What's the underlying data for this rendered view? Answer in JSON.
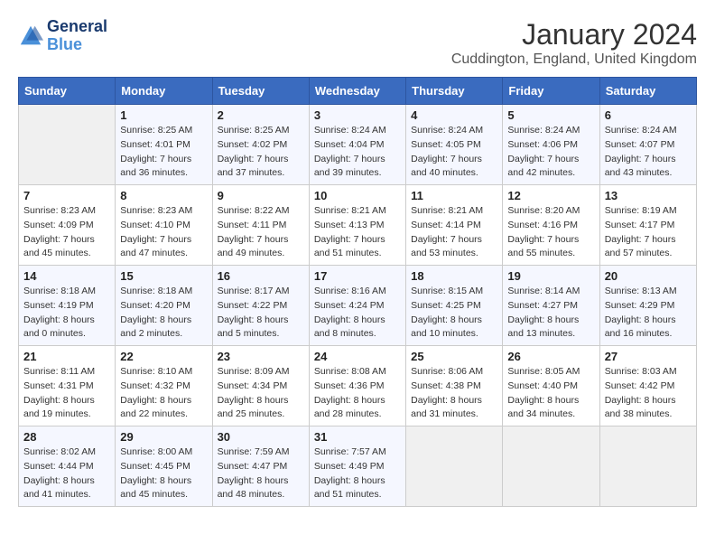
{
  "header": {
    "logo_line1": "General",
    "logo_line2": "Blue",
    "month": "January 2024",
    "location": "Cuddington, England, United Kingdom"
  },
  "days_of_week": [
    "Sunday",
    "Monday",
    "Tuesday",
    "Wednesday",
    "Thursday",
    "Friday",
    "Saturday"
  ],
  "weeks": [
    [
      {
        "num": "",
        "empty": true
      },
      {
        "num": "1",
        "sunrise": "8:25 AM",
        "sunset": "4:01 PM",
        "daylight": "7 hours and 36 minutes."
      },
      {
        "num": "2",
        "sunrise": "8:25 AM",
        "sunset": "4:02 PM",
        "daylight": "7 hours and 37 minutes."
      },
      {
        "num": "3",
        "sunrise": "8:24 AM",
        "sunset": "4:04 PM",
        "daylight": "7 hours and 39 minutes."
      },
      {
        "num": "4",
        "sunrise": "8:24 AM",
        "sunset": "4:05 PM",
        "daylight": "7 hours and 40 minutes."
      },
      {
        "num": "5",
        "sunrise": "8:24 AM",
        "sunset": "4:06 PM",
        "daylight": "7 hours and 42 minutes."
      },
      {
        "num": "6",
        "sunrise": "8:24 AM",
        "sunset": "4:07 PM",
        "daylight": "7 hours and 43 minutes."
      }
    ],
    [
      {
        "num": "7",
        "sunrise": "8:23 AM",
        "sunset": "4:09 PM",
        "daylight": "7 hours and 45 minutes."
      },
      {
        "num": "8",
        "sunrise": "8:23 AM",
        "sunset": "4:10 PM",
        "daylight": "7 hours and 47 minutes."
      },
      {
        "num": "9",
        "sunrise": "8:22 AM",
        "sunset": "4:11 PM",
        "daylight": "7 hours and 49 minutes."
      },
      {
        "num": "10",
        "sunrise": "8:21 AM",
        "sunset": "4:13 PM",
        "daylight": "7 hours and 51 minutes."
      },
      {
        "num": "11",
        "sunrise": "8:21 AM",
        "sunset": "4:14 PM",
        "daylight": "7 hours and 53 minutes."
      },
      {
        "num": "12",
        "sunrise": "8:20 AM",
        "sunset": "4:16 PM",
        "daylight": "7 hours and 55 minutes."
      },
      {
        "num": "13",
        "sunrise": "8:19 AM",
        "sunset": "4:17 PM",
        "daylight": "7 hours and 57 minutes."
      }
    ],
    [
      {
        "num": "14",
        "sunrise": "8:18 AM",
        "sunset": "4:19 PM",
        "daylight": "8 hours and 0 minutes."
      },
      {
        "num": "15",
        "sunrise": "8:18 AM",
        "sunset": "4:20 PM",
        "daylight": "8 hours and 2 minutes."
      },
      {
        "num": "16",
        "sunrise": "8:17 AM",
        "sunset": "4:22 PM",
        "daylight": "8 hours and 5 minutes."
      },
      {
        "num": "17",
        "sunrise": "8:16 AM",
        "sunset": "4:24 PM",
        "daylight": "8 hours and 8 minutes."
      },
      {
        "num": "18",
        "sunrise": "8:15 AM",
        "sunset": "4:25 PM",
        "daylight": "8 hours and 10 minutes."
      },
      {
        "num": "19",
        "sunrise": "8:14 AM",
        "sunset": "4:27 PM",
        "daylight": "8 hours and 13 minutes."
      },
      {
        "num": "20",
        "sunrise": "8:13 AM",
        "sunset": "4:29 PM",
        "daylight": "8 hours and 16 minutes."
      }
    ],
    [
      {
        "num": "21",
        "sunrise": "8:11 AM",
        "sunset": "4:31 PM",
        "daylight": "8 hours and 19 minutes."
      },
      {
        "num": "22",
        "sunrise": "8:10 AM",
        "sunset": "4:32 PM",
        "daylight": "8 hours and 22 minutes."
      },
      {
        "num": "23",
        "sunrise": "8:09 AM",
        "sunset": "4:34 PM",
        "daylight": "8 hours and 25 minutes."
      },
      {
        "num": "24",
        "sunrise": "8:08 AM",
        "sunset": "4:36 PM",
        "daylight": "8 hours and 28 minutes."
      },
      {
        "num": "25",
        "sunrise": "8:06 AM",
        "sunset": "4:38 PM",
        "daylight": "8 hours and 31 minutes."
      },
      {
        "num": "26",
        "sunrise": "8:05 AM",
        "sunset": "4:40 PM",
        "daylight": "8 hours and 34 minutes."
      },
      {
        "num": "27",
        "sunrise": "8:03 AM",
        "sunset": "4:42 PM",
        "daylight": "8 hours and 38 minutes."
      }
    ],
    [
      {
        "num": "28",
        "sunrise": "8:02 AM",
        "sunset": "4:44 PM",
        "daylight": "8 hours and 41 minutes."
      },
      {
        "num": "29",
        "sunrise": "8:00 AM",
        "sunset": "4:45 PM",
        "daylight": "8 hours and 45 minutes."
      },
      {
        "num": "30",
        "sunrise": "7:59 AM",
        "sunset": "4:47 PM",
        "daylight": "8 hours and 48 minutes."
      },
      {
        "num": "31",
        "sunrise": "7:57 AM",
        "sunset": "4:49 PM",
        "daylight": "8 hours and 51 minutes."
      },
      {
        "num": "",
        "empty": true
      },
      {
        "num": "",
        "empty": true
      },
      {
        "num": "",
        "empty": true
      }
    ]
  ]
}
